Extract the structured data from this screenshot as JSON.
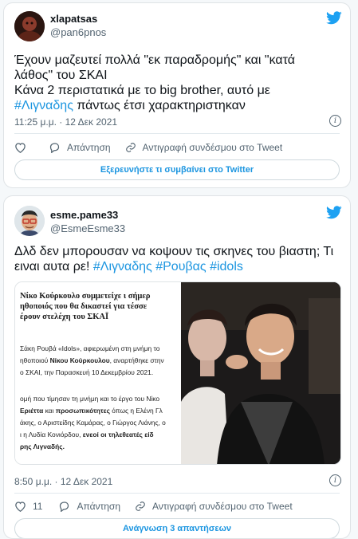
{
  "tweets": [
    {
      "author_name": "xlapatsas",
      "author_handle": "@pan6pnos",
      "text_line1": "Έχουν μαζευτεί πολλά \"εκ παραδρομής\" και \"κατά",
      "text_line2": "λάθος\" του ΣΚΑΙ",
      "text_line3": "Κάνα 2 περιστατικά με το big brother, αυτό με",
      "text_hashtag": "#Λιγναδης",
      "text_line4_rest": " πάντως έτσι χαρακτηριστηκαν",
      "timestamp": "11:25 μ.μ. · 12 Δεκ 2021",
      "like_count": "",
      "reply_label": "Απάντηση",
      "copy_label": "Αντιγραφή συνδέσμου στο Tweet",
      "footer_button": "Εξερευνήστε τι συμβαίνει στο Twitter"
    },
    {
      "author_name": "esme.pame33",
      "author_handle": "@EsmeEsme33",
      "text_line1": "Δλδ δεν μπορουσαν να κοψουν τις σκηνες του βιαστη; Τι",
      "text_line2_plain": "ειναι αυτα ρε!",
      "hashtags": [
        "#Λιγναδης",
        "#Ρουβας",
        "#idols"
      ],
      "timestamp": "8:50 μ.μ. · 12 Δεκ 2021",
      "like_count": "11",
      "reply_label": "Απάντηση",
      "copy_label": "Αντιγραφή συνδέσμου στο Tweet",
      "footer_button": "Ανάγνωση 3 απαντήσεων",
      "media": {
        "headline_1": "Νίκο Κούρκουλο συμμετείχε ι σήμερ",
        "headline_2": "ηθοποιός που θα δικαστεί για τέσσε",
        "headline_3": "έρουν στελέχη του ΣΚΑΪ",
        "p1a": "Σάκη Ρουβά «Idols», αφιερωμένη στη μνήμη το",
        "p2a_pre": "ηθοποιού ",
        "p2a_bold": "Νίκου Κούρκουλου",
        "p2a_post": ", αναρτήθηκε στην",
        "p3a": "ο ΣΚΑΙ, την Παρασκευή 10 Δεκεμβρίου 2021.",
        "p4a": "ομή που τίμησαν τη μνήμη και το έργο του Νίκο",
        "p5a_bold1": "Εριέττα",
        "p5a_mid": " και ",
        "p5a_bold2": "προσωπικότητες",
        "p5a_post": " όπως η Ελένη Γλ",
        "p6a": "άκης, ο Αριστείδης Καμάρας, ο Γιώργος Λιάνης, ο",
        "p7a_pre": "ι η Λυδία Κονιόρδου, ",
        "p7a_bold": "ενεοί οι τηλεθεατές είδ",
        "p8a_bold": "ρης Λιγναδής."
      }
    }
  ],
  "colors": {
    "link": "#1b95e0",
    "bird": "#1da1f2"
  }
}
